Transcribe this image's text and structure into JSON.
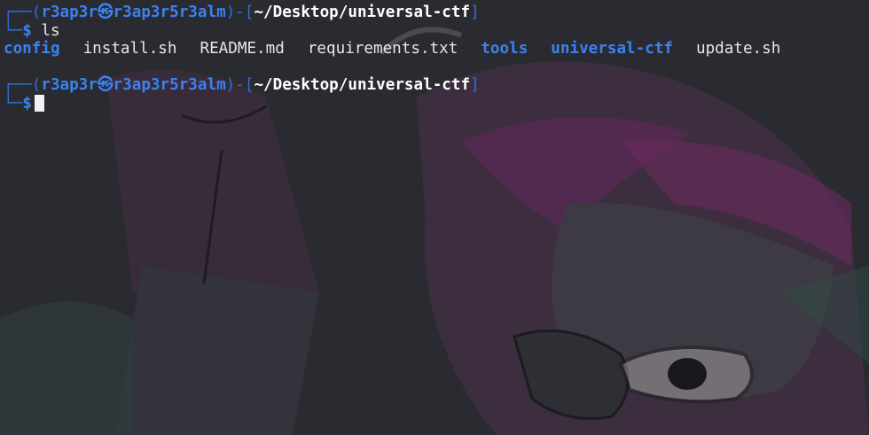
{
  "theme": {
    "background": "#2a2b31",
    "prompt_blue": "#3b82f0",
    "bracket_blue": "#2f6fd6",
    "text": "#e6e6e6",
    "path_white": "#ffffff"
  },
  "background_art": {
    "icon": "anime-character-wallpaper"
  },
  "prompts": [
    {
      "corner_top": "┌──(",
      "user": "r3ap3r",
      "at_symbol": "㉿",
      "host": "r3ap3r5r3alm",
      "mid": ")-[",
      "path": "~/Desktop/universal-ctf",
      "close": "]",
      "corner_bottom": "└─",
      "symbol": "$",
      "command": " ls"
    },
    {
      "corner_top": "┌──(",
      "user": "r3ap3r",
      "at_symbol": "㉿",
      "host": "r3ap3r5r3alm",
      "mid": ")-[",
      "path": "~/Desktop/universal-ctf",
      "close": "]",
      "corner_bottom": "└─",
      "symbol": "$",
      "command": ""
    }
  ],
  "ls_output": [
    {
      "name": "config",
      "type": "dir"
    },
    {
      "name": "install.sh",
      "type": "file"
    },
    {
      "name": "README.md",
      "type": "file"
    },
    {
      "name": "requirements.txt",
      "type": "file"
    },
    {
      "name": "tools",
      "type": "dir"
    },
    {
      "name": "universal-ctf",
      "type": "dir"
    },
    {
      "name": "update.sh",
      "type": "file"
    }
  ]
}
